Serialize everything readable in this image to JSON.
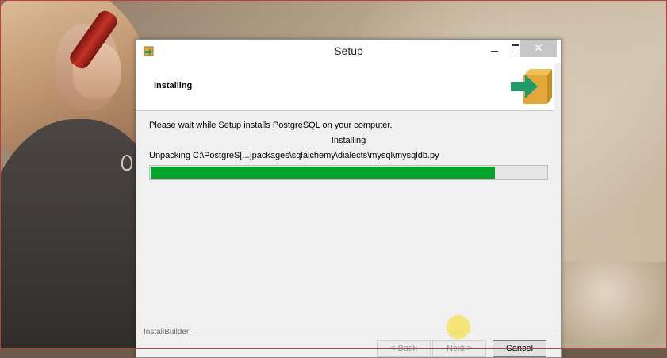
{
  "window": {
    "title": "Setup",
    "controls": {
      "minimize": "minimize-icon",
      "maximize": "maximize-icon",
      "close": "✕"
    }
  },
  "header": {
    "title": "Installing"
  },
  "body": {
    "message": "Please wait while Setup installs PostgreSQL on your computer.",
    "status": "Installing",
    "current_file": "Unpacking C:\\PostgreS[...]packages\\sqlalchemy\\dialects\\mysql\\mysqldb.py",
    "progress_fraction": 0.87
  },
  "footer": {
    "brand": "InstallBuilder",
    "back_label": "< Back",
    "next_label": "Next >",
    "cancel_label": "Cancel"
  },
  "colors": {
    "progress": "#06a32c",
    "icon_box": "#e2a93a",
    "icon_arrow": "#1f9a6a"
  }
}
